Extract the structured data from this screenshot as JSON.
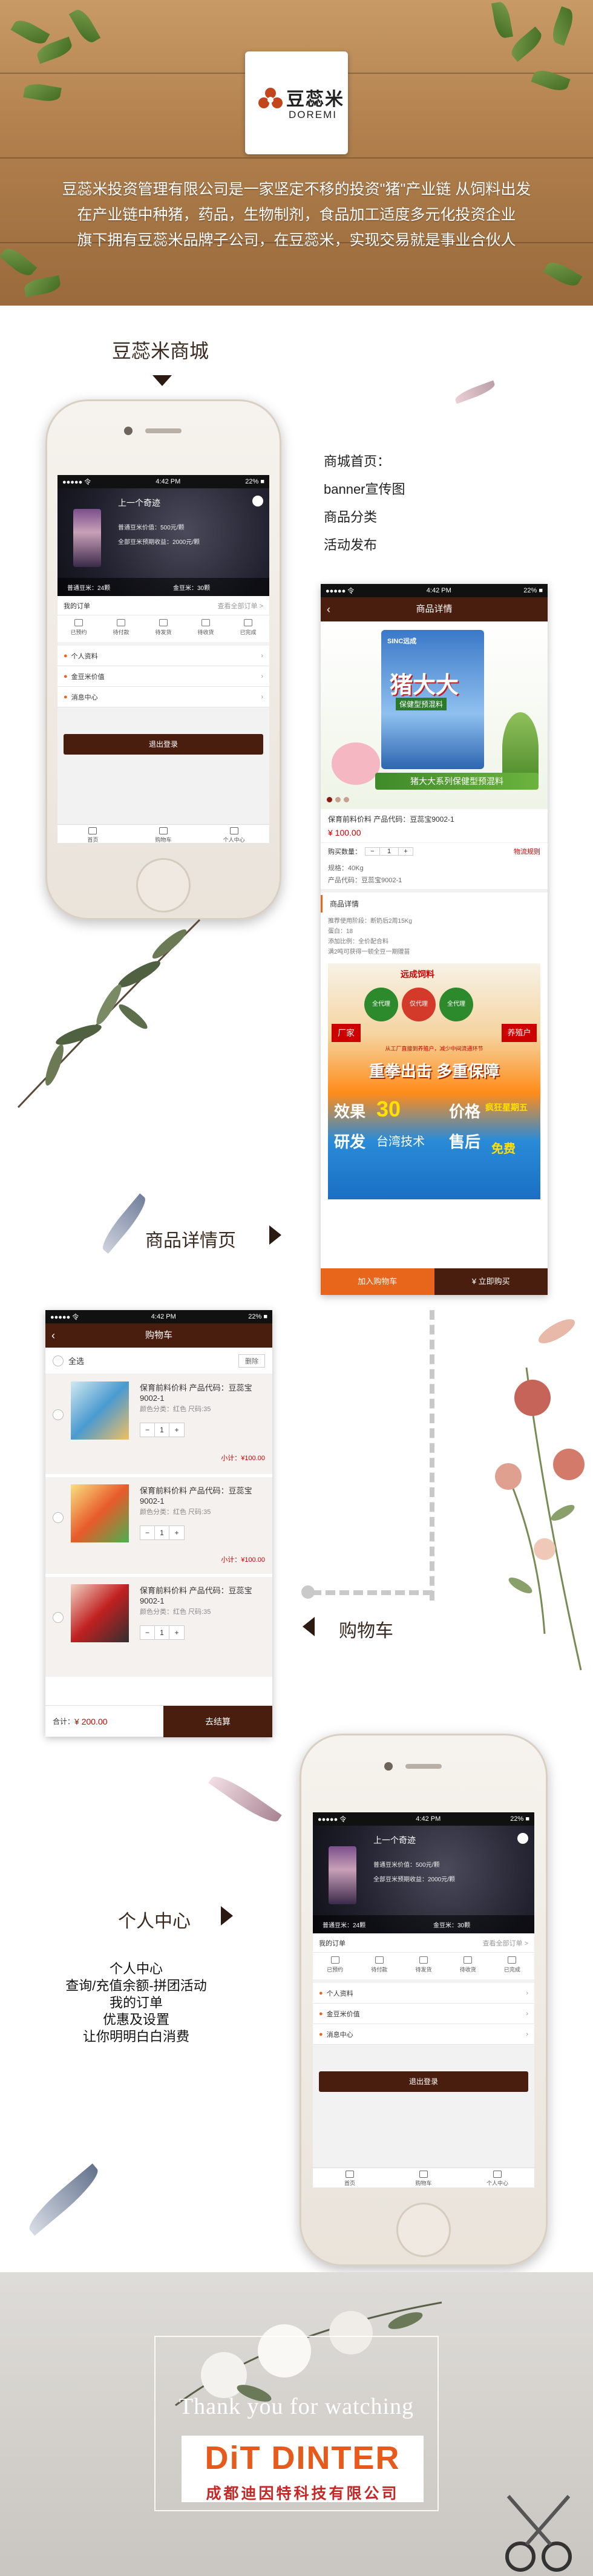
{
  "header": {
    "logo_cn": "豆蕊米",
    "logo_en": "DOREMI",
    "intro_lines": [
      "豆蕊米投资管理有限公司是一家坚定不移的投资\"猪\"产业链 从饲料出发",
      "在产业链中种猪，药品，生物制剂，食品加工适度多元化投资企业",
      "旗下拥有豆蕊米品牌子公司，在豆蕊米，实现交易就是事业合伙人"
    ]
  },
  "section_mall": {
    "title": "豆蕊米商城"
  },
  "home_list": [
    "商城首页：",
    "banner宣传图",
    "商品分类",
    "活动发布"
  ],
  "profile_screen": {
    "status_left": "●●●●● 令",
    "status_time": "4:42 PM",
    "status_right": "22% ■",
    "username": "上一个奇迹",
    "info_1": "普通豆米价值：500元/颗",
    "info_2": "全部豆米预期收益：2000元/颗",
    "tickets_left": "普通豆米：24颗",
    "tickets_right": "金豆米：30颗",
    "orders_label": "我的订单",
    "orders_right": "查看全部订单 >",
    "quick_items": [
      "已预约",
      "待付款",
      "待发货",
      "待收货",
      "已完成"
    ],
    "menu": [
      "个人资料",
      "金豆米价值",
      "消息中心"
    ],
    "logout": "退出登录",
    "tabs": [
      "首页",
      "购物车",
      "个人中心"
    ]
  },
  "detail_screen": {
    "status_left": "●●●●● 令",
    "status_time": "4:42 PM",
    "status_right": "22% ■",
    "title": "商品详情",
    "bag_brand": "SINC远成",
    "bag_name": "猪大大",
    "bag_sub": "保健型预混料",
    "promo_banner": "猪大大系列保健型预混料",
    "product_name": "保育前料价料 产品代码：豆蕊宝9002-1",
    "price": "¥ 100.00",
    "qty_label": "购买数量：",
    "qty": "1",
    "logistics": "物流规则",
    "spec": "规格：40Kg",
    "code": "产品代码：豆蕊宝9002-1",
    "section_label": "商品详情",
    "desc": [
      "推荐使用阶段：断奶后2周15Kg",
      "蛋白：18",
      "添加比例：全价配合料",
      "满2吨可获得一顿全豆一期赠苗"
    ],
    "poster_brand": "远成饲料",
    "poster_tags": [
      "全代理",
      "仅代理",
      "全代理"
    ],
    "poster_side_left": "厂家",
    "poster_side_right": "养殖户",
    "poster_strip": "从工厂直接到养殖户，减少中间流通环节",
    "poster_headline": "重拳出击 多重保障",
    "poster_words": [
      "效果",
      "研发",
      "台湾技术",
      "价格",
      "售后",
      "疯狂星期五",
      "免费"
    ],
    "poster_days": "30",
    "add_cart": "加入购物车",
    "buy_now": "¥ 立即购买"
  },
  "section_detail": {
    "title": "商品详情页"
  },
  "cart_screen": {
    "status_left": "●●●●● 令",
    "status_time": "4:42 PM",
    "status_right": "22% ■",
    "title": "购物车",
    "select_all": "全选",
    "delete": "删除",
    "items": [
      {
        "name": "保育前料价料 产品代码：豆蕊宝9002-1",
        "attr": "颜色分类：红色  尺码:35",
        "qty": "1",
        "subtotal": "小计：¥100.00"
      },
      {
        "name": "保育前料价料 产品代码：豆蕊宝9002-1",
        "attr": "颜色分类：红色  尺码:35",
        "qty": "1",
        "subtotal": "小计：¥100.00"
      },
      {
        "name": "保育前料价料 产品代码：豆蕊宝9002-1",
        "attr": "颜色分类：红色  尺码:35",
        "qty": "1",
        "subtotal": "小计：¥100.00"
      }
    ],
    "total_label": "合计：",
    "total_value": "¥ 200.00",
    "checkout": "去结算"
  },
  "section_cart": {
    "title": "购物车"
  },
  "section_center": {
    "title": "个人中心",
    "lines": [
      "个人中心",
      "查询/充值余额-拼团活动",
      "我的订单",
      "优惠及设置",
      "让你明明白白消费"
    ]
  },
  "footer": {
    "thanks": "Thank you for watching",
    "brand": "DiT DINTER",
    "brand_cn": "成都迪因特科技有限公司"
  },
  "colors": {
    "brand_dark": "#4a1e0e",
    "price_red": "#c00000",
    "accent_orange": "#e8661c"
  }
}
